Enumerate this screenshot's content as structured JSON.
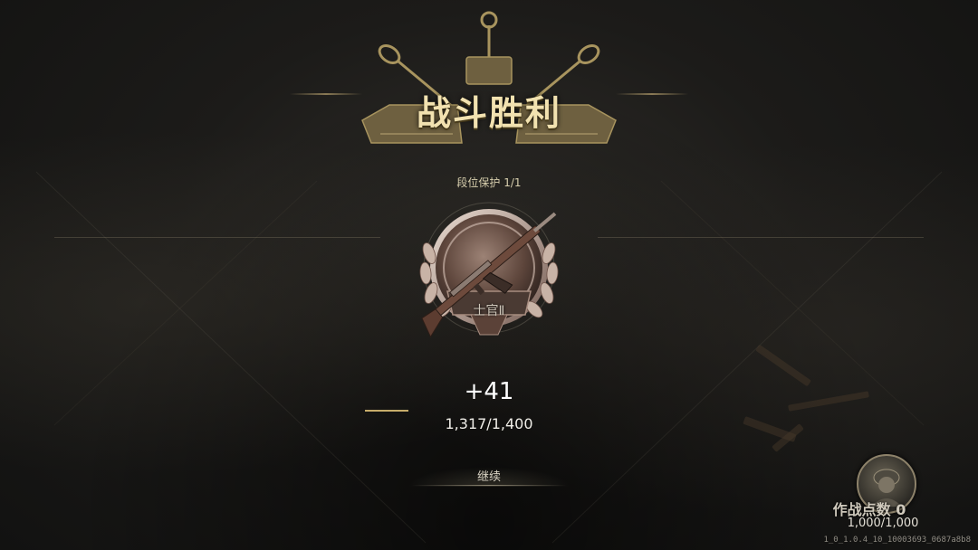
{
  "banner": {
    "title": "战斗胜利"
  },
  "rank": {
    "protection_text": "段位保护 1/1",
    "name": "士官Ⅱ",
    "points_delta": "+41",
    "progress_text": "1,317/1,400",
    "progress_fraction": 0.94
  },
  "continue_label": "继续",
  "combat_points": {
    "label": "作战点数 0",
    "value": "1,000/1,000"
  },
  "version": "1_0_1.0.4_10_10003693_0687a8b8",
  "colors": {
    "gold": "#c7ac6a",
    "bronze": "#7a5a48"
  },
  "icons": [
    "tank-emblem-icon",
    "rifle-icon",
    "laurel-icon",
    "soldier-avatar-icon"
  ]
}
